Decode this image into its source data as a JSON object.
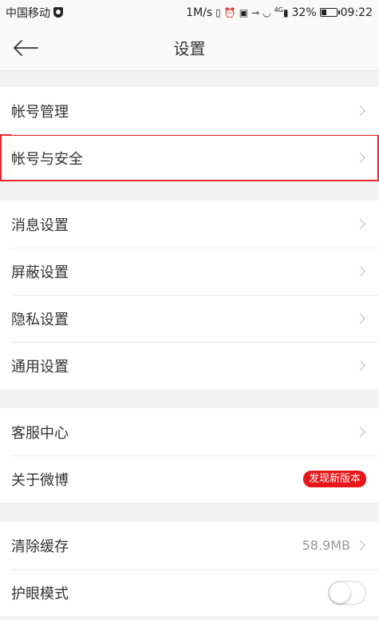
{
  "status_bar": {
    "carrier": "中国移动",
    "speed": "1M/s",
    "signal_label": "4G",
    "battery": "32%",
    "time": "09:22",
    "icons": [
      "shield-icon",
      "vibrate-icon",
      "alarm-icon",
      "hd-icon",
      "key-icon",
      "wifi-icon",
      "signal-icon",
      "battery-icon"
    ]
  },
  "header": {
    "title": "设置"
  },
  "groups": [
    {
      "items": [
        {
          "label": "帐号管理"
        },
        {
          "label": "帐号与安全"
        }
      ]
    },
    {
      "items": [
        {
          "label": "消息设置"
        },
        {
          "label": "屏蔽设置"
        },
        {
          "label": "隐私设置"
        },
        {
          "label": "通用设置"
        }
      ]
    },
    {
      "items": [
        {
          "label": "客服中心"
        },
        {
          "label": "关于微博",
          "badge": "发现新版本"
        }
      ]
    },
    {
      "items": [
        {
          "label": "清除缓存",
          "value": "58.9MB"
        },
        {
          "label": "护眼模式",
          "toggle": false
        }
      ]
    }
  ],
  "colors": {
    "highlight": "#e5262c",
    "badge": "#e8161b"
  }
}
